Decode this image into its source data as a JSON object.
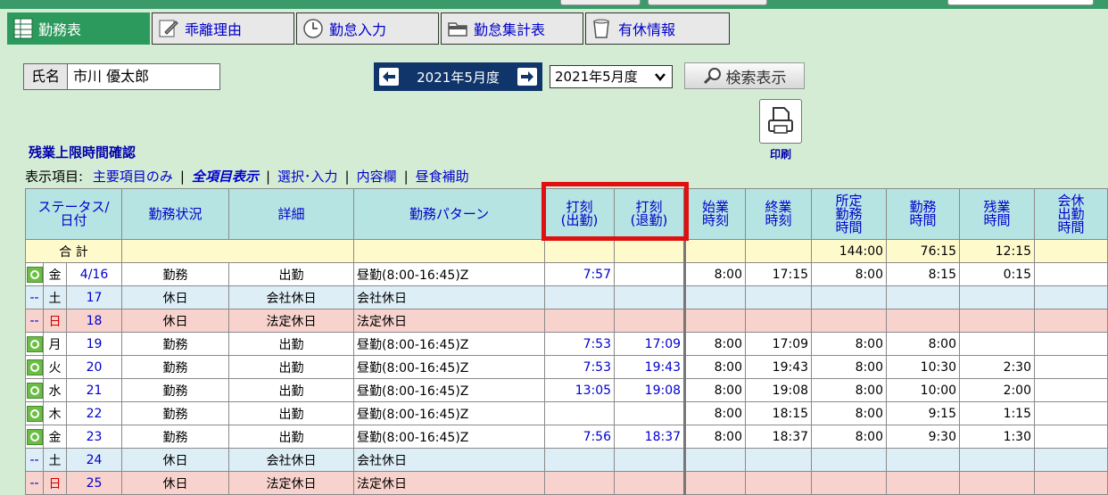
{
  "tabs": [
    {
      "label": "勤務表",
      "icon": "grid-icon",
      "active": true
    },
    {
      "label": "乖離理由",
      "icon": "pencil-icon",
      "active": false
    },
    {
      "label": "勤怠入力",
      "icon": "clock-icon",
      "active": false
    },
    {
      "label": "勤怠集計表",
      "icon": "folder-icon",
      "active": false
    },
    {
      "label": "有休情報",
      "icon": "cup-icon",
      "active": false
    }
  ],
  "employee": {
    "label": "氏名",
    "name": "市川 優太郎"
  },
  "period": {
    "current": "2021年5月度",
    "selected": "2021年5月度"
  },
  "search_label": "検索表示",
  "print_label": "印刷",
  "overtime_link": "残業上限時間確認",
  "display_items": {
    "prefix": "表示項目:",
    "options": [
      "主要項目のみ",
      "全項目表示",
      "選択･入力",
      "内容欄",
      "昼食補助"
    ],
    "current": "全項目表示"
  },
  "table": {
    "headers": [
      [
        "ステータス/",
        "日付"
      ],
      [
        "勤務状況"
      ],
      [
        "詳細"
      ],
      [
        "勤務パターン"
      ],
      [
        "打刻",
        "(出勤)"
      ],
      [
        "打刻",
        "(退勤)"
      ],
      [
        "始業",
        "時刻"
      ],
      [
        "終業",
        "時刻"
      ],
      [
        "所定",
        "勤務",
        "時間"
      ],
      [
        "勤務",
        "時間"
      ],
      [
        "残業",
        "時間"
      ],
      [
        "会休",
        "出勤",
        "時間"
      ]
    ],
    "total": {
      "label": "合 計",
      "scheduled": "144:00",
      "work": "76:15",
      "overtime": "12:15"
    },
    "rows": [
      {
        "status": "○",
        "dow": "金",
        "date": "4/16",
        "type": "勤務",
        "detail": "出勤",
        "pattern": "昼勤(8:00-16:45)Z",
        "in": "7:57",
        "out": "",
        "start": "8:00",
        "end": "17:15",
        "scheduled": "8:00",
        "work": "8:15",
        "overtime": "0:15",
        "kind": "work"
      },
      {
        "status": "--",
        "dow": "土",
        "date": "17",
        "type": "休日",
        "detail": "会社休日",
        "pattern": "会社休日",
        "in": "",
        "out": "",
        "start": "",
        "end": "",
        "scheduled": "",
        "work": "",
        "overtime": "",
        "kind": "hol"
      },
      {
        "status": "--",
        "dow": "日",
        "date": "18",
        "type": "休日",
        "detail": "法定休日",
        "pattern": "法定休日",
        "in": "",
        "out": "",
        "start": "",
        "end": "",
        "scheduled": "",
        "work": "",
        "overtime": "",
        "kind": "ph"
      },
      {
        "status": "○",
        "dow": "月",
        "date": "19",
        "type": "勤務",
        "detail": "出勤",
        "pattern": "昼勤(8:00-16:45)Z",
        "in": "7:53",
        "out": "17:09",
        "start": "8:00",
        "end": "17:09",
        "scheduled": "8:00",
        "work": "8:00",
        "overtime": "",
        "kind": "work"
      },
      {
        "status": "○",
        "dow": "火",
        "date": "20",
        "type": "勤務",
        "detail": "出勤",
        "pattern": "昼勤(8:00-16:45)Z",
        "in": "7:53",
        "out": "19:43",
        "start": "8:00",
        "end": "19:43",
        "scheduled": "8:00",
        "work": "10:30",
        "overtime": "2:30",
        "kind": "work"
      },
      {
        "status": "○",
        "dow": "水",
        "date": "21",
        "type": "勤務",
        "detail": "出勤",
        "pattern": "昼勤(8:00-16:45)Z",
        "in": "13:05",
        "out": "19:08",
        "start": "8:00",
        "end": "19:08",
        "scheduled": "8:00",
        "work": "10:00",
        "overtime": "2:00",
        "kind": "work"
      },
      {
        "status": "○",
        "dow": "木",
        "date": "22",
        "type": "勤務",
        "detail": "出勤",
        "pattern": "昼勤(8:00-16:45)Z",
        "in": "",
        "out": "",
        "start": "8:00",
        "end": "18:15",
        "scheduled": "8:00",
        "work": "9:15",
        "overtime": "1:15",
        "kind": "work"
      },
      {
        "status": "○",
        "dow": "金",
        "date": "23",
        "type": "勤務",
        "detail": "出勤",
        "pattern": "昼勤(8:00-16:45)Z",
        "in": "7:56",
        "out": "18:37",
        "start": "8:00",
        "end": "18:37",
        "scheduled": "8:00",
        "work": "9:30",
        "overtime": "1:30",
        "kind": "work"
      },
      {
        "status": "--",
        "dow": "土",
        "date": "24",
        "type": "休日",
        "detail": "会社休日",
        "pattern": "会社休日",
        "in": "",
        "out": "",
        "start": "",
        "end": "",
        "scheduled": "",
        "work": "",
        "overtime": "",
        "kind": "hol"
      },
      {
        "status": "--",
        "dow": "日",
        "date": "25",
        "type": "休日",
        "detail": "法定休日",
        "pattern": "法定休日",
        "in": "",
        "out": "",
        "start": "",
        "end": "",
        "scheduled": "",
        "work": "",
        "overtime": "",
        "kind": "ph"
      }
    ]
  },
  "colors": {
    "accent": "#2c9a5c",
    "nav": "#10356a",
    "highlight": "#e01010",
    "link": "#0000cc"
  }
}
